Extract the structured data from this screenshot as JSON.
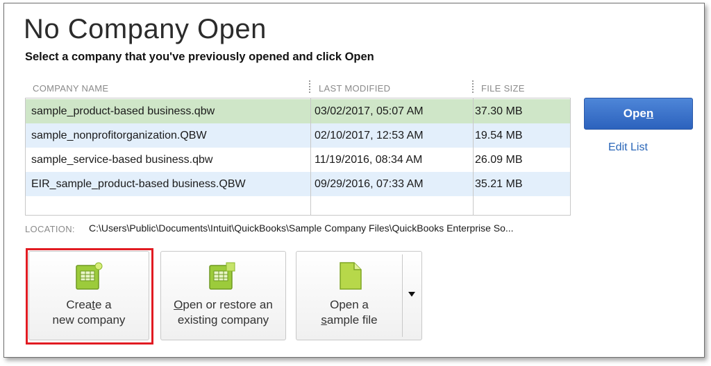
{
  "window": {
    "title": "No Company Open",
    "subtitle": "Select a company that you've previously opened and click Open"
  },
  "table": {
    "columns": [
      "COMPANY NAME",
      "LAST MODIFIED",
      "FILE SIZE"
    ],
    "rows": [
      {
        "name": "sample_product-based business.qbw",
        "modified": "03/02/2017, 05:07 AM",
        "size": "37.30 MB"
      },
      {
        "name": "sample_nonprofitorganization.QBW",
        "modified": "02/10/2017, 12:53 AM",
        "size": "19.54 MB"
      },
      {
        "name": "sample_service-based business.qbw",
        "modified": "11/19/2016, 08:34 AM",
        "size": "26.09 MB"
      },
      {
        "name": "EIR_sample_product-based business.QBW",
        "modified": "09/29/2016, 07:33 AM",
        "size": "35.21 MB"
      }
    ],
    "selected_row_color": "#cfe6c8"
  },
  "actions": {
    "open_prefix": "Ope",
    "open_mnemonic": "n",
    "edit_list": "Edit List"
  },
  "location": {
    "label": "LOCATION:",
    "path": "C:\\Users\\Public\\Documents\\Intuit\\QuickBooks\\Sample Company Files\\QuickBooks Enterprise So..."
  },
  "tiles": {
    "create": {
      "line1_a": "Crea",
      "line1_u": "t",
      "line1_b": "e a",
      "line2": "new company",
      "icon": "new-company-icon"
    },
    "restore": {
      "line1_a": "",
      "line1_u": "O",
      "line1_b": "pen or restore an",
      "line2": "existing company",
      "icon": "open-company-icon"
    },
    "sample": {
      "line1": "Open a",
      "line2_u": "s",
      "line2_b": "ample file",
      "icon": "sample-file-icon"
    }
  },
  "colors": {
    "accent_blue": "#2c62bd",
    "link_blue": "#2a66b8",
    "highlight_red": "#e11b22",
    "icon_green": "#9ccb3b"
  }
}
